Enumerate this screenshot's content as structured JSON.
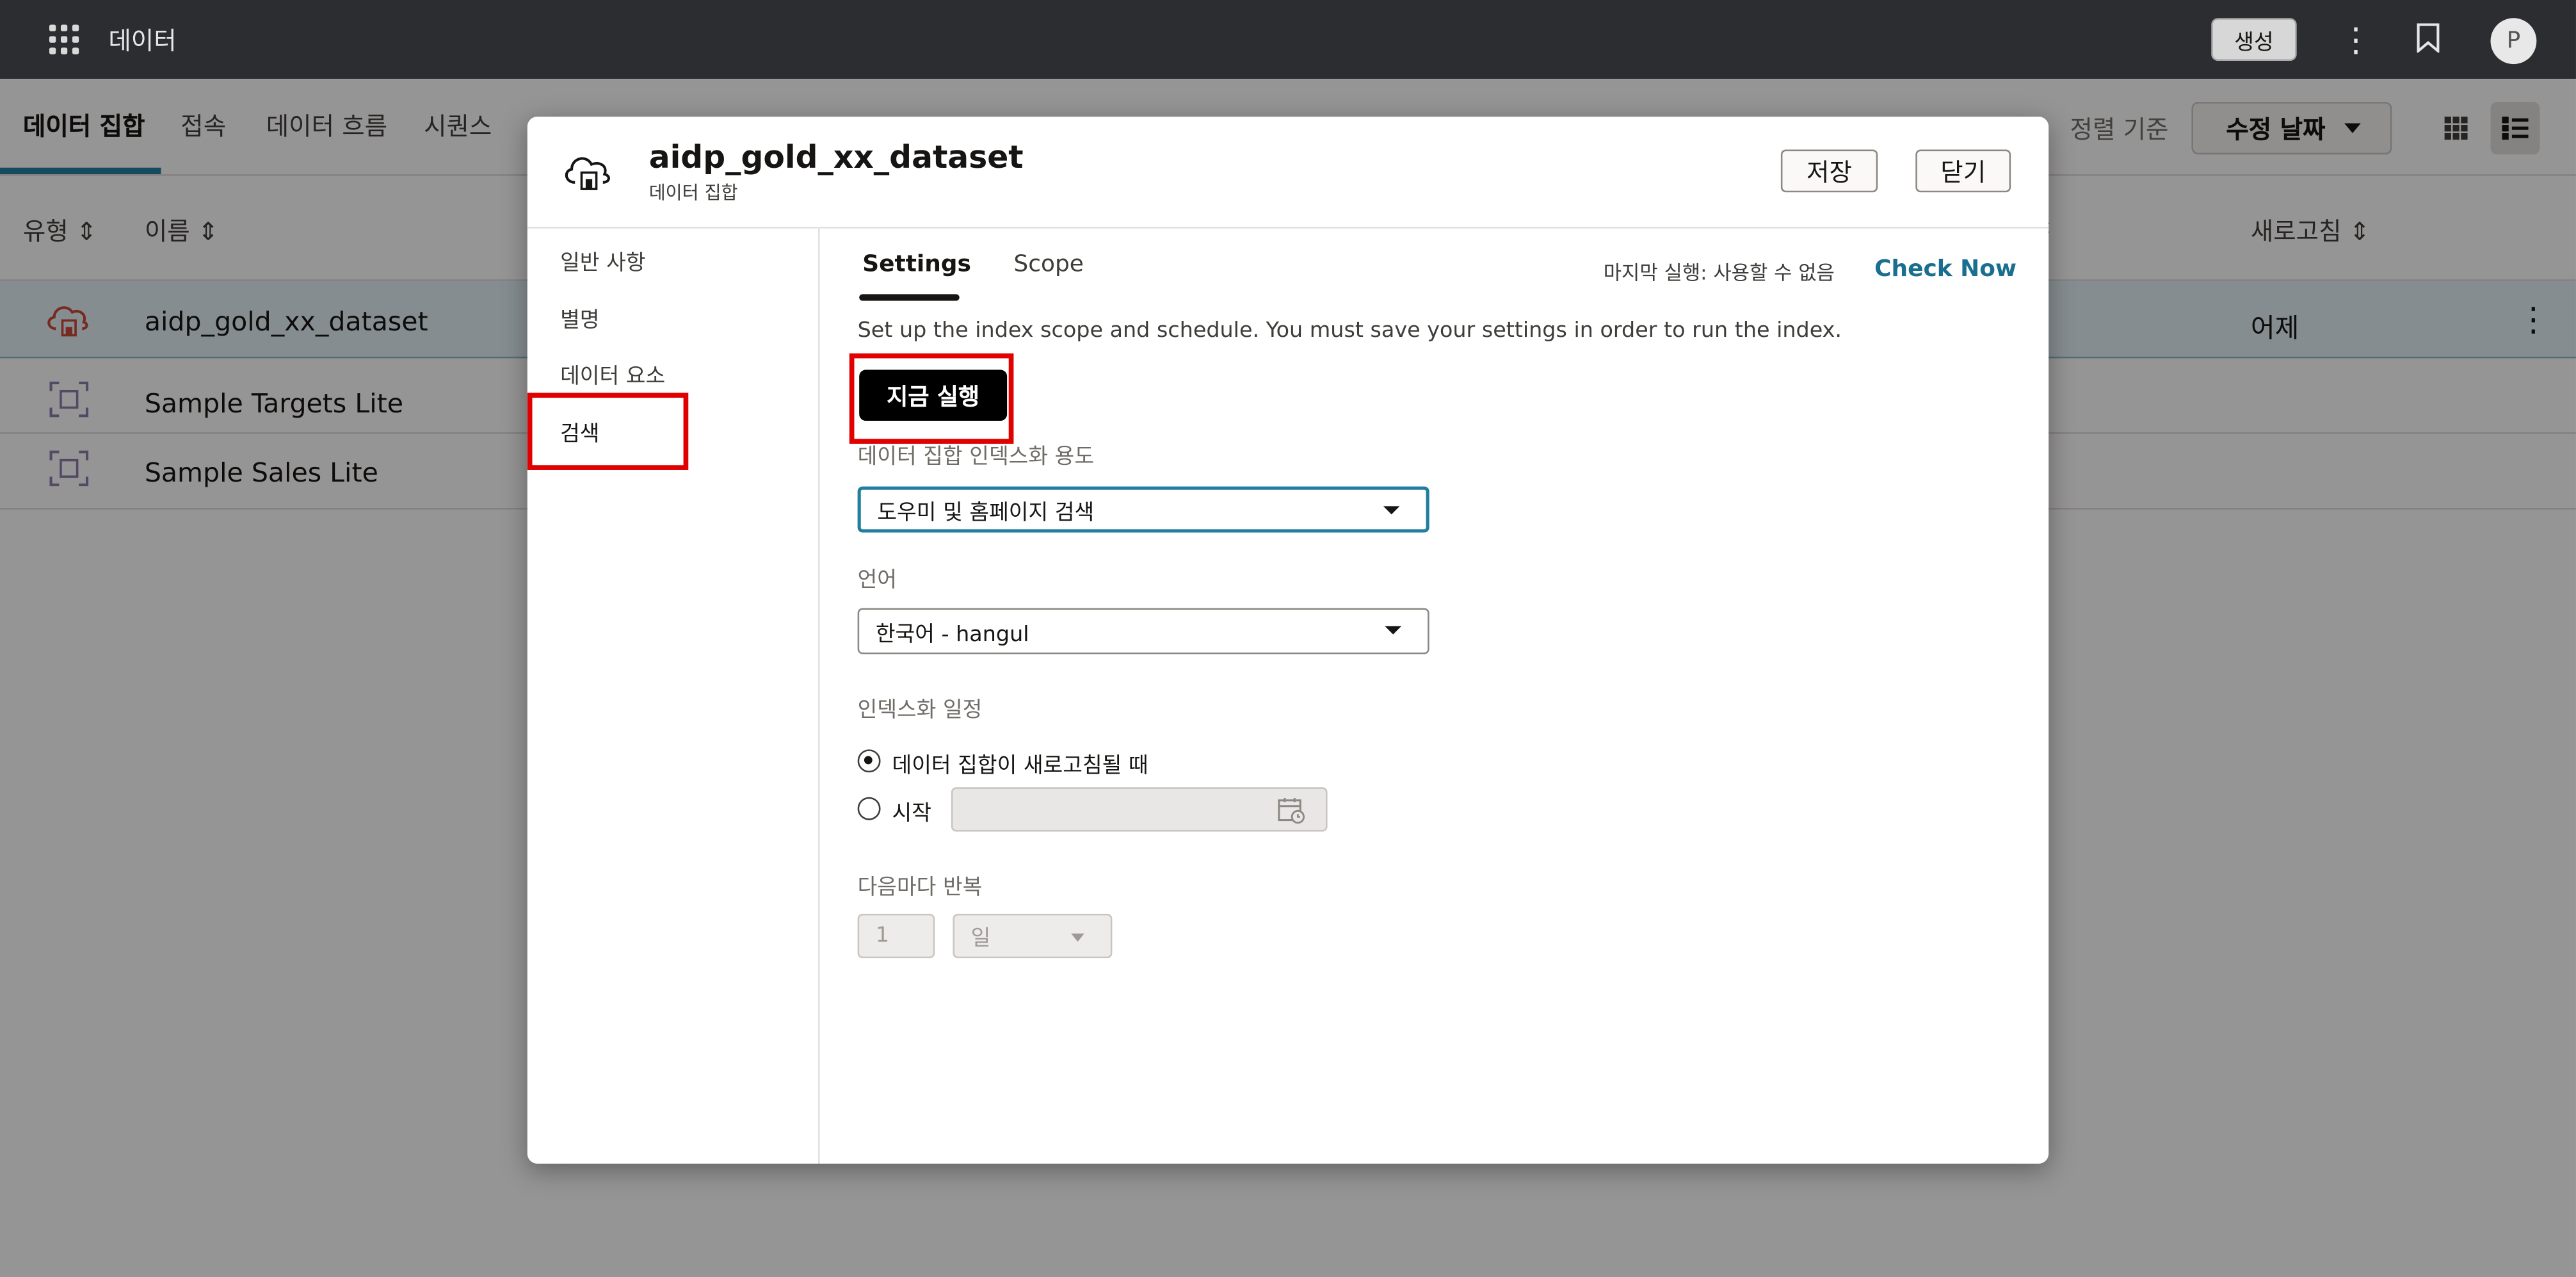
{
  "topbar": {
    "app_title": "데이터",
    "create_label": "생성",
    "avatar_initial": "P"
  },
  "subnav": {
    "tabs": [
      "데이터 집합",
      "접속",
      "데이터 흐름",
      "시퀀스"
    ],
    "sort_label": "정렬 기준",
    "sort_value": "수정 날짜"
  },
  "list": {
    "columns": {
      "type": "유형",
      "name": "이름",
      "refresh": "새로고침"
    },
    "rows": [
      {
        "name": "aidp_gold_xx_dataset",
        "refresh": "어제",
        "icon": "cloud-dataset-icon"
      },
      {
        "name": "Sample Targets Lite",
        "refresh": "",
        "icon": "focus-frame-icon"
      },
      {
        "name": "Sample Sales Lite",
        "refresh": "",
        "icon": "focus-frame-icon"
      }
    ]
  },
  "modal": {
    "title": "aidp_gold_xx_dataset",
    "subtitle": "데이터 집합",
    "save_label": "저장",
    "close_label": "닫기",
    "sidebar": [
      "일반 사항",
      "별명",
      "데이터 요소",
      "검색"
    ],
    "tabs": {
      "settings": "Settings",
      "scope": "Scope"
    },
    "last_run": "마지막 실행: 사용할 수 없음",
    "check_now": "Check Now",
    "description": "Set up the index scope and schedule. You must save your settings in order to run the index.",
    "run_now": "지금 실행",
    "usage_label": "데이터 집합 인덱스화 용도",
    "usage_value": "도우미 및 홈페이지 검색",
    "language_label": "언어",
    "language_value": "한국어 - hangul",
    "schedule_label": "인덱스화 일정",
    "schedule_opt1": "데이터 집합이 새로고침될 때",
    "schedule_opt2": "시작",
    "repeat_label": "다음마다 반복",
    "repeat_value": "1",
    "repeat_unit": "일"
  },
  "colors": {
    "accent": "#227e9e",
    "highlight": "#e00000",
    "topbar": "#2b2d30"
  }
}
